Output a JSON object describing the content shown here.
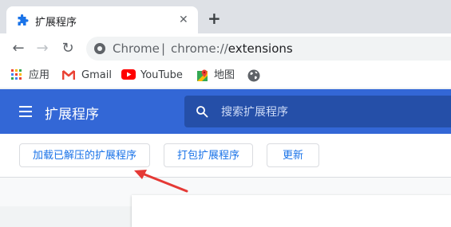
{
  "tab": {
    "title": "扩展程序",
    "favicon": "puzzle-piece-icon",
    "close_glyph": "✕",
    "new_tab_glyph": "+"
  },
  "toolbar": {
    "back_glyph": "←",
    "forward_glyph": "→",
    "reload_glyph": "↻",
    "site_label": "Chrome",
    "separator": "|",
    "url_scheme": "chrome://",
    "url_path": "extensions"
  },
  "bookmarks": [
    {
      "label": "应用",
      "icon": "apps-grid-icon"
    },
    {
      "label": "Gmail",
      "icon": "gmail-icon"
    },
    {
      "label": "YouTube",
      "icon": "youtube-icon"
    },
    {
      "label": "地图",
      "icon": "maps-pin-icon"
    },
    {
      "label": "",
      "icon": "globe-icon"
    }
  ],
  "header": {
    "title": "扩展程序",
    "menu_icon": "hamburger-menu-icon",
    "search_placeholder": "搜索扩展程序",
    "search_icon": "search-icon"
  },
  "actions": {
    "load_unpacked": "加载已解压的扩展程序",
    "pack": "打包扩展程序",
    "update": "更新"
  },
  "annotation": {
    "arrow_color": "#e53935"
  },
  "colors": {
    "header_bg": "#3367d6",
    "button_text": "#1a73e8"
  }
}
